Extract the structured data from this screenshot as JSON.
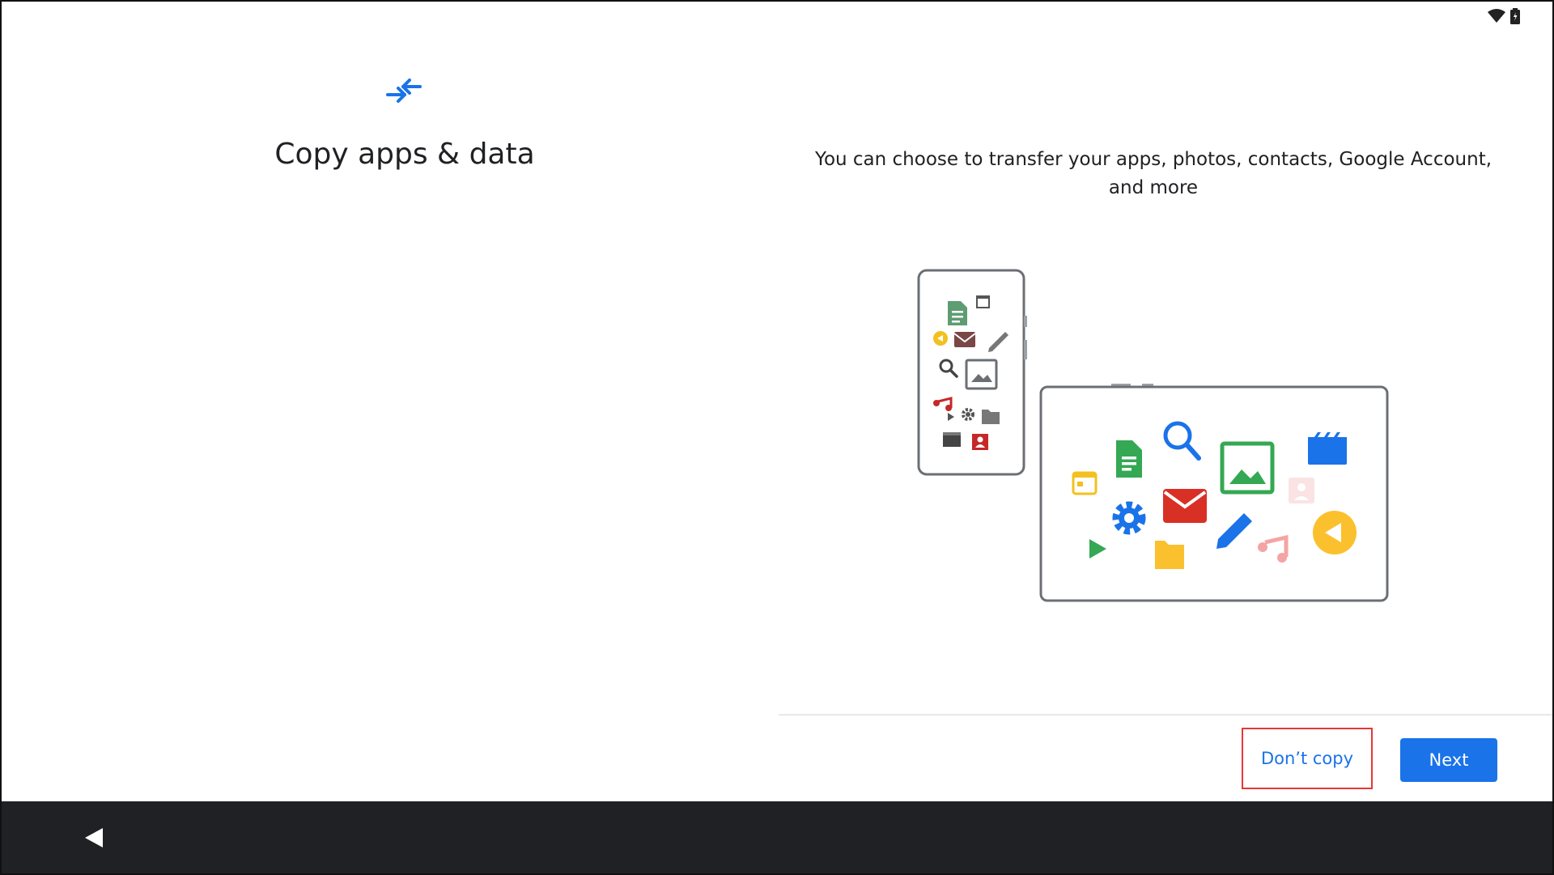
{
  "status_bar": {
    "icons": [
      "wifi-icon",
      "battery-icon"
    ]
  },
  "header": {
    "icon": "transfer-arrows-icon",
    "title": "Copy apps & data"
  },
  "main": {
    "description": "You can choose to transfer your apps, photos, contacts, Google Account, and more",
    "illustration": "phone-to-tablet-transfer-illustration"
  },
  "footer": {
    "secondary_label": "Don’t copy",
    "primary_label": "Next"
  },
  "nav_bar": {
    "back_icon": "back-triangle-icon"
  },
  "colors": {
    "accent": "#1a73e8",
    "nav_bar": "#202124",
    "highlight_border": "#e53935"
  }
}
